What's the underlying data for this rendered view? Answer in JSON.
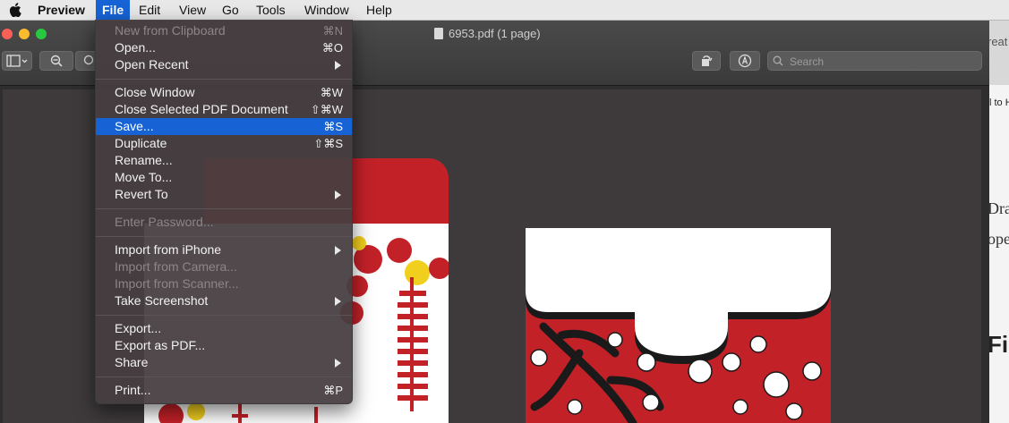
{
  "menubar": {
    "items": [
      "Preview",
      "File",
      "Edit",
      "View",
      "Go",
      "Tools",
      "Window",
      "Help"
    ]
  },
  "window": {
    "title": "6953.pdf (1 page)",
    "search_placeholder": "Search"
  },
  "file_menu": {
    "items": [
      {
        "label": "New from Clipboard",
        "shortcut": "⌘N",
        "enabled": false
      },
      {
        "label": "Open...",
        "shortcut": "⌘O",
        "enabled": true
      },
      {
        "label": "Open Recent",
        "submenu": true,
        "enabled": true
      },
      {
        "label": "Close Window",
        "shortcut": "⌘W",
        "enabled": true
      },
      {
        "label": "Close Selected PDF Document",
        "shortcut": "⇧⌘W",
        "enabled": true
      },
      {
        "label": "Save...",
        "shortcut": "⌘S",
        "enabled": true,
        "highlighted": true
      },
      {
        "label": "Duplicate",
        "shortcut": "⇧⌘S",
        "enabled": true
      },
      {
        "label": "Rename...",
        "enabled": true
      },
      {
        "label": "Move To...",
        "enabled": true
      },
      {
        "label": "Revert To",
        "submenu": true,
        "enabled": true
      },
      {
        "label": "Enter Password...",
        "enabled": false
      },
      {
        "label": "Import from iPhone",
        "submenu": true,
        "enabled": true
      },
      {
        "label": "Import from Camera...",
        "enabled": false
      },
      {
        "label": "Import from Scanner...",
        "enabled": false
      },
      {
        "label": "Take Screenshot",
        "submenu": true,
        "enabled": true
      },
      {
        "label": "Export...",
        "enabled": true
      },
      {
        "label": "Export as PDF...",
        "enabled": true
      },
      {
        "label": "Share",
        "submenu": true,
        "enabled": true
      },
      {
        "label": "Print...",
        "shortcut": "⌘P",
        "enabled": true
      }
    ]
  },
  "background_window": {
    "fragments": [
      "reat",
      "l to H",
      "Dra",
      "ope",
      "Fil"
    ]
  },
  "colors": {
    "menu_highlight": "#1763d6",
    "envelope_red": "#c32128",
    "page_background": "#3e3a3b"
  }
}
